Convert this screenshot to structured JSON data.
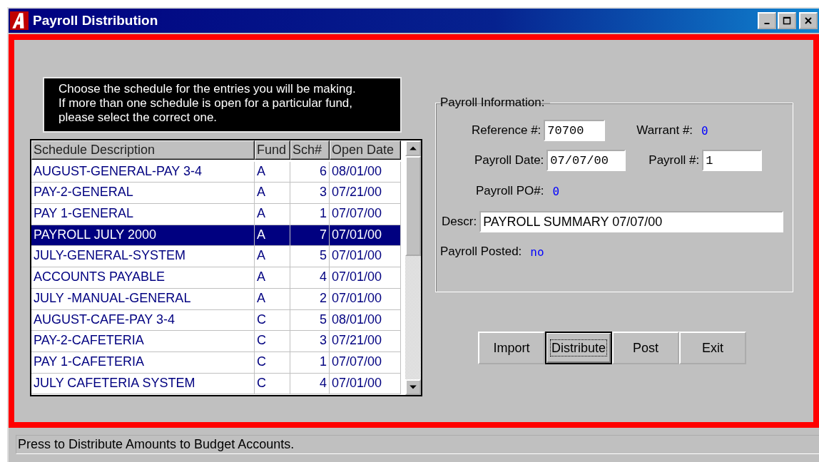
{
  "window": {
    "title": "Payroll Distribution"
  },
  "instructions": "Choose the schedule for the entries you will be making.\nIf more than one schedule is open for a particular fund,\nplease select the correct one.",
  "table": {
    "columns": [
      {
        "label": "Schedule Description",
        "kind": "text"
      },
      {
        "label": "Fund",
        "kind": "text"
      },
      {
        "label": "Sch#",
        "kind": "number"
      },
      {
        "label": "Open Date",
        "kind": "text"
      }
    ],
    "rows": [
      {
        "cells": [
          "AUGUST-GENERAL-PAY 3-4",
          "A",
          "6",
          "08/01/00"
        ],
        "selected": false
      },
      {
        "cells": [
          "PAY-2-GENERAL",
          "A",
          "3",
          "07/21/00"
        ],
        "selected": false
      },
      {
        "cells": [
          "PAY 1-GENERAL",
          "A",
          "1",
          "07/07/00"
        ],
        "selected": false
      },
      {
        "cells": [
          "PAYROLL JULY 2000",
          "A",
          "7",
          "07/01/00"
        ],
        "selected": true
      },
      {
        "cells": [
          "JULY-GENERAL-SYSTEM",
          "A",
          "5",
          "07/01/00"
        ],
        "selected": false
      },
      {
        "cells": [
          "ACCOUNTS PAYABLE",
          "A",
          "4",
          "07/01/00"
        ],
        "selected": false
      },
      {
        "cells": [
          "JULY -MANUAL-GENERAL",
          "A",
          "2",
          "07/01/00"
        ],
        "selected": false
      },
      {
        "cells": [
          "AUGUST-CAFE-PAY 3-4",
          "C",
          "5",
          "08/01/00"
        ],
        "selected": false
      },
      {
        "cells": [
          "PAY-2-CAFETERIA",
          "C",
          "3",
          "07/21/00"
        ],
        "selected": false
      },
      {
        "cells": [
          "PAY 1-CAFETERIA",
          "C",
          "1",
          "07/07/00"
        ],
        "selected": false
      },
      {
        "cells": [
          "JULY CAFETERIA SYSTEM",
          "C",
          "4",
          "07/01/00"
        ],
        "selected": false
      }
    ]
  },
  "payroll_info": {
    "title": "Payroll Information:",
    "rows": [
      [
        {
          "label": "Reference #:",
          "value": "70700",
          "kind": "input"
        },
        {
          "label": "Warrant #:",
          "value": "0",
          "kind": "readout"
        }
      ],
      [
        {
          "label": "Payroll Date:",
          "value": "07/07/00",
          "kind": "input"
        },
        {
          "label": "Payroll #:",
          "value": "1",
          "kind": "input"
        }
      ],
      [
        {
          "label": "Payroll PO#:",
          "value": "0",
          "kind": "readout"
        }
      ],
      [
        {
          "label": "Descr:",
          "value": "PAYROLL SUMMARY 07/07/00",
          "kind": "wide"
        }
      ],
      [
        {
          "label": "Payroll Posted:",
          "value": "no",
          "kind": "readout"
        }
      ]
    ]
  },
  "buttons": [
    {
      "label": "Import",
      "focused": false
    },
    {
      "label": "Distribute",
      "focused": true
    },
    {
      "label": "Post",
      "focused": false
    },
    {
      "label": "Exit",
      "focused": false
    }
  ],
  "status_bar": "Press to Distribute Amounts to Budget Accounts."
}
